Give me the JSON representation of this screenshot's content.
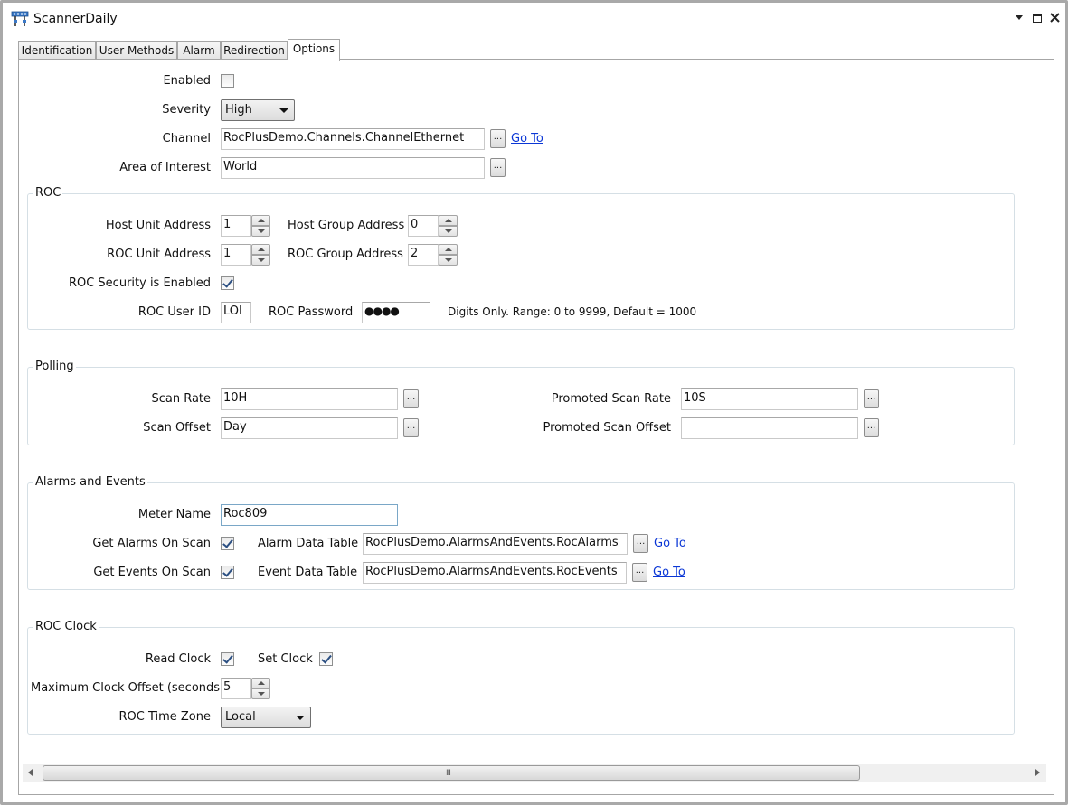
{
  "window": {
    "title": "ScannerDaily",
    "icon": "network-scanner-icon",
    "controls": [
      "dropdown-arrow",
      "maximize",
      "close"
    ]
  },
  "tabs": [
    {
      "label": "Identification"
    },
    {
      "label": "User Methods"
    },
    {
      "label": "Alarm"
    },
    {
      "label": "Redirection"
    },
    {
      "label": "Options",
      "active": true
    }
  ],
  "general": {
    "enabled_label": "Enabled",
    "enabled": false,
    "severity_label": "Severity",
    "severity_value": "High",
    "channel_label": "Channel",
    "channel_value": "RocPlusDemo.Channels.ChannelEthernet",
    "channel_goto": "Go To",
    "area_label": "Area of Interest",
    "area_value": "World",
    "browse_label": "..."
  },
  "roc": {
    "title": "ROC",
    "host_unit_label": "Host Unit Address",
    "host_unit_value": "1",
    "host_group_label": "Host Group Address",
    "host_group_value": "0",
    "roc_unit_label": "ROC Unit Address",
    "roc_unit_value": "1",
    "roc_group_label": "ROC Group Address",
    "roc_group_value": "2",
    "security_label": "ROC Security is Enabled",
    "security_enabled": true,
    "user_id_label": "ROC User ID",
    "user_id_value": "LOI",
    "password_label": "ROC Password",
    "password_value": "●●●●",
    "password_hint": "Digits Only. Range: 0 to 9999, Default = 1000"
  },
  "polling": {
    "title": "Polling",
    "scan_rate_label": "Scan Rate",
    "scan_rate_value": "10H",
    "scan_offset_label": "Scan Offset",
    "scan_offset_value": "Day",
    "promoted_rate_label": "Promoted Scan Rate",
    "promoted_rate_value": "10S",
    "promoted_offset_label": "Promoted Scan Offset",
    "promoted_offset_value": ""
  },
  "alarms_events": {
    "title": "Alarms and Events",
    "meter_name_label": "Meter Name",
    "meter_name_value": "Roc809",
    "get_alarms_label": "Get Alarms On Scan",
    "get_alarms": true,
    "alarm_table_label": "Alarm Data Table",
    "alarm_table_value": "RocPlusDemo.AlarmsAndEvents.RocAlarms",
    "alarm_goto": "Go To",
    "get_events_label": "Get Events On Scan",
    "get_events": true,
    "event_table_label": "Event Data Table",
    "event_table_value": "RocPlusDemo.AlarmsAndEvents.RocEvents",
    "event_goto": "Go To"
  },
  "roc_clock": {
    "title": "ROC Clock",
    "read_clock_label": "Read Clock",
    "read_clock": true,
    "set_clock_label": "Set Clock",
    "set_clock": true,
    "max_offset_label": "Maximum Clock Offset (seconds)",
    "max_offset_value": "5",
    "time_zone_label": "ROC Time Zone",
    "time_zone_value": "Local"
  },
  "scrollbar": {
    "grip": "III"
  },
  "colors": {
    "link": "#0b37d6",
    "group_border": "#d5dfe5",
    "window_border": "#a9a9a9"
  }
}
